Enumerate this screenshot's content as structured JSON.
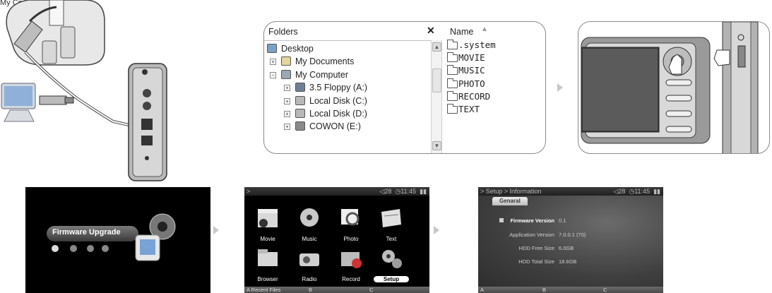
{
  "caption": "My Computer",
  "explorer": {
    "folders_title": "Folders",
    "close_glyph": "✕",
    "tree": [
      {
        "label": "Desktop",
        "indent": 0,
        "icon": "desktop-icon",
        "toggle": ""
      },
      {
        "label": "My Documents",
        "indent": 1,
        "icon": "documents-icon",
        "toggle": "+"
      },
      {
        "label": "My Computer",
        "indent": 1,
        "icon": "computer-icon",
        "toggle": "−"
      },
      {
        "label": "3.5 Floppy (A:)",
        "indent": 2,
        "icon": "floppy-icon",
        "toggle": "+"
      },
      {
        "label": "Local Disk (C:)",
        "indent": 2,
        "icon": "disk-icon",
        "toggle": "+"
      },
      {
        "label": "Local Disk (D:)",
        "indent": 2,
        "icon": "disk-icon",
        "toggle": "+"
      },
      {
        "label": "COWON (E:)",
        "indent": 2,
        "icon": "removable-drive-icon",
        "toggle": "+"
      }
    ],
    "name_header": "Name",
    "files": [
      ".system",
      "MOVIE",
      "MUSIC",
      "PHOTO",
      "RECORD",
      "TEXT"
    ]
  },
  "firmware_screen": {
    "label": "Firmware Upgrade"
  },
  "menu_screen": {
    "status_left": ">",
    "volume": "28",
    "clock": "11:45",
    "items": [
      {
        "label": "Movie",
        "icon": "movie-clapper-icon"
      },
      {
        "label": "Music",
        "icon": "music-disc-icon"
      },
      {
        "label": "Photo",
        "icon": "photo-magnifier-icon"
      },
      {
        "label": "Text",
        "icon": "text-book-icon"
      },
      {
        "label": "Browser",
        "icon": "browser-folder-icon"
      },
      {
        "label": "Radio",
        "icon": "radio-icon"
      },
      {
        "label": "Record",
        "icon": "record-tv-icon"
      },
      {
        "label": "Setup",
        "icon": "setup-gears-icon"
      }
    ],
    "selected": "Setup",
    "bottom_bar": [
      "A Recent Files",
      "B",
      "C"
    ]
  },
  "info_screen": {
    "breadcrumb": "> Setup > Information",
    "volume": "28",
    "clock": "11:45",
    "tab": "Genaral",
    "rows": [
      {
        "key": "Firmware Version",
        "value": "0.1"
      },
      {
        "key": "Application Version",
        "value": "7.0.0.1 (70)"
      },
      {
        "key": "HDD Free Size",
        "value": "6.0GB"
      },
      {
        "key": "HDD Total Size",
        "value": "18.6GB"
      }
    ],
    "bottom_bar": [
      "A",
      "B",
      "C"
    ]
  }
}
